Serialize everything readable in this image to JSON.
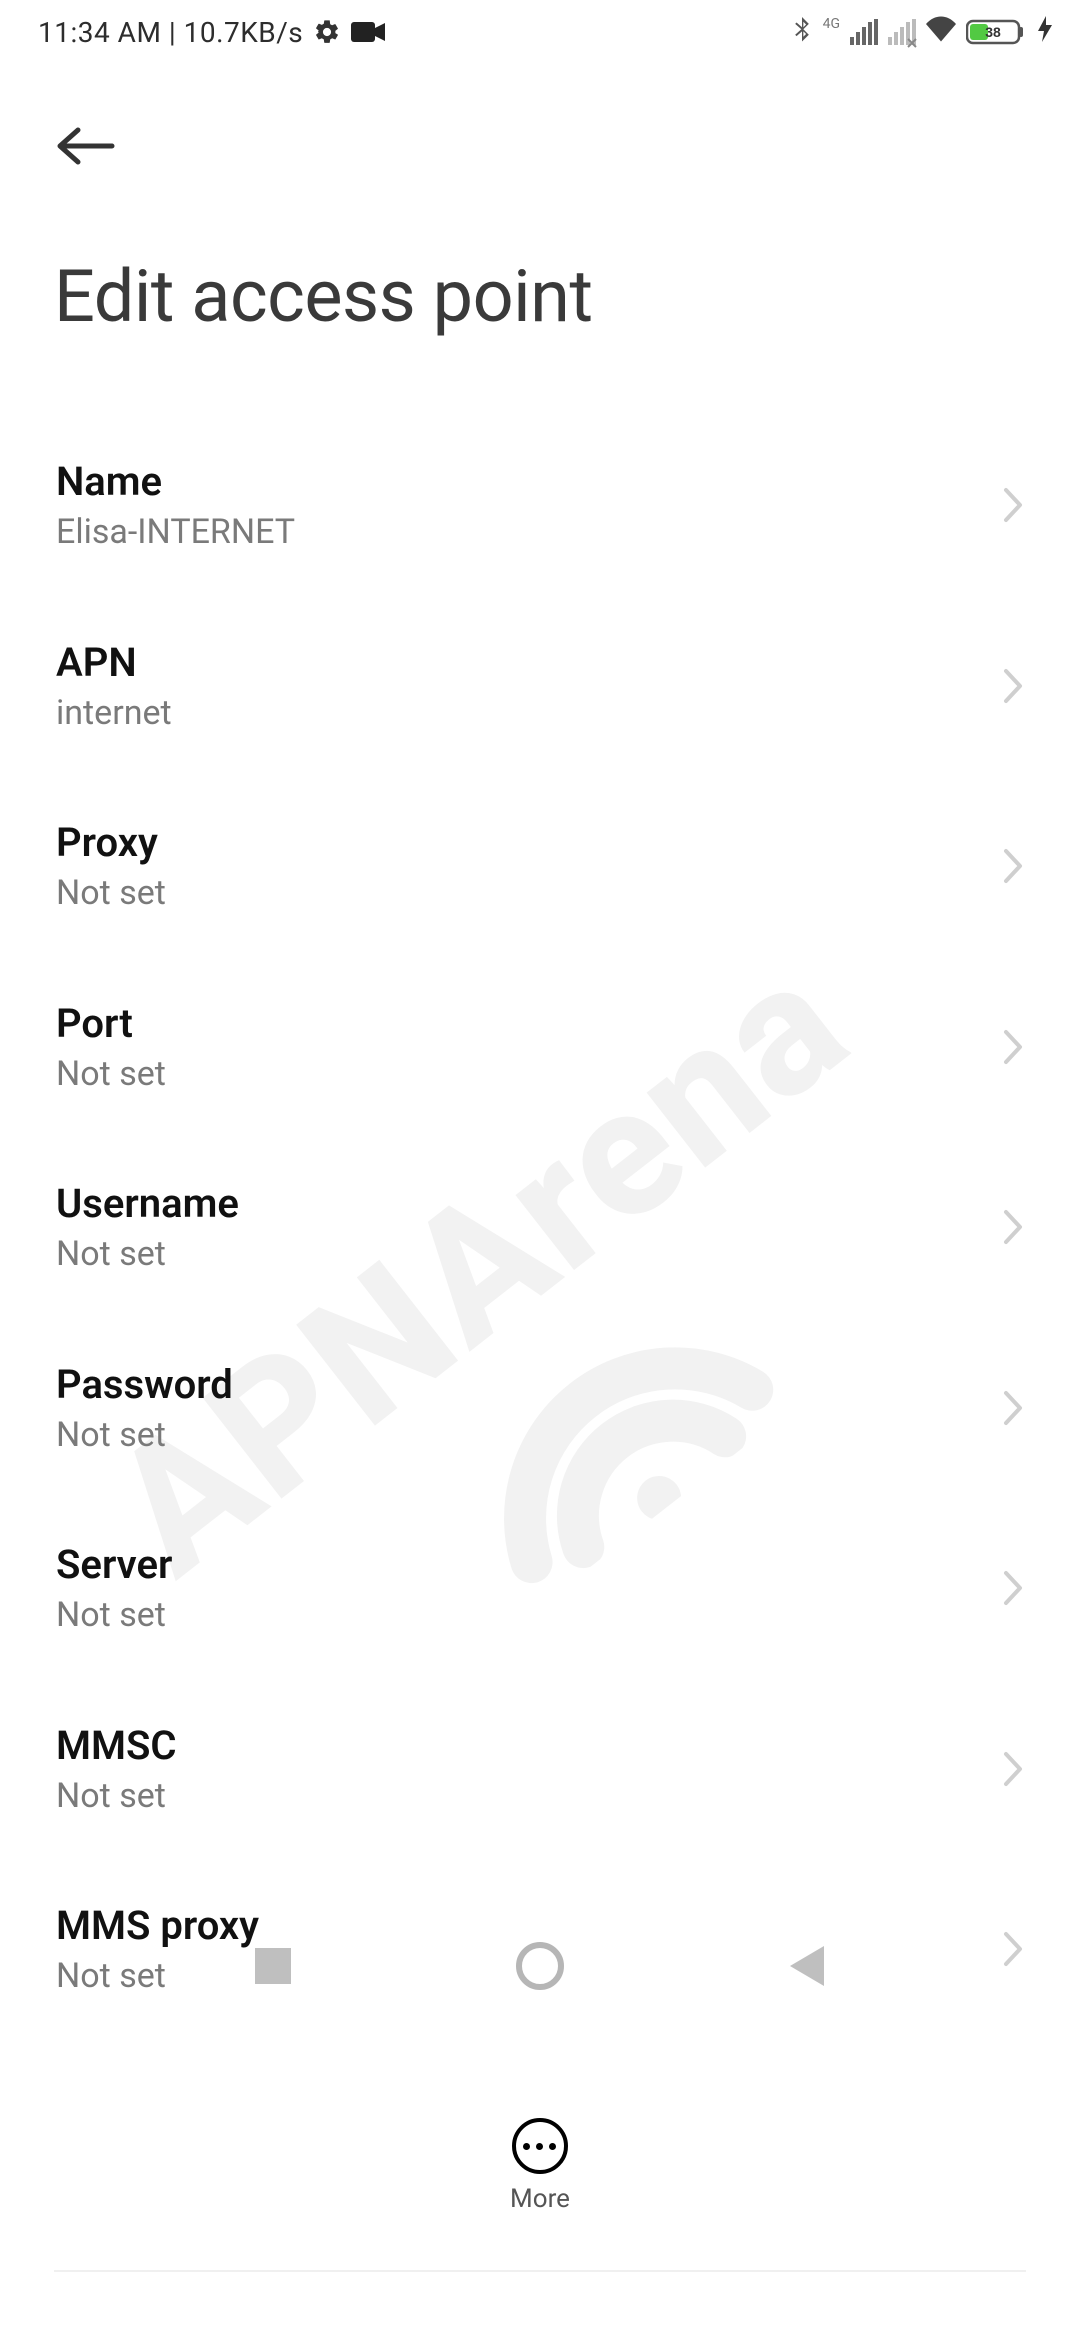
{
  "status": {
    "time": "11:34 AM",
    "separator": " | ",
    "speed": "10.7KB/s",
    "network_badge": "4G",
    "battery_percent": "38"
  },
  "header": {
    "title": "Edit access point"
  },
  "apn": {
    "items": [
      {
        "label": "Name",
        "value": "Elisa-INTERNET"
      },
      {
        "label": "APN",
        "value": "internet"
      },
      {
        "label": "Proxy",
        "value": "Not set"
      },
      {
        "label": "Port",
        "value": "Not set"
      },
      {
        "label": "Username",
        "value": "Not set"
      },
      {
        "label": "Password",
        "value": "Not set"
      },
      {
        "label": "Server",
        "value": "Not set"
      },
      {
        "label": "MMSC",
        "value": "Not set"
      },
      {
        "label": "MMS proxy",
        "value": "Not set"
      }
    ]
  },
  "actions": {
    "more": "More"
  },
  "watermark": {
    "text": "APNArena"
  }
}
